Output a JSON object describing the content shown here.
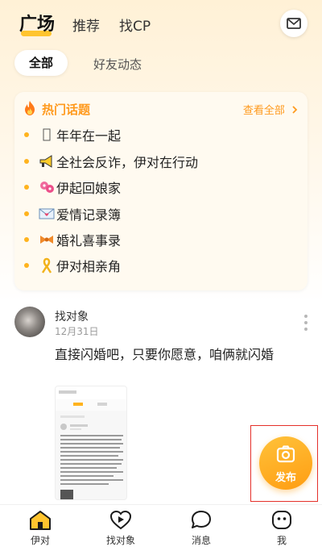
{
  "header": {
    "tabs": [
      {
        "label": "广场",
        "active": true
      },
      {
        "label": "推荐",
        "active": false
      },
      {
        "label": "找CP",
        "active": false
      }
    ],
    "mail_icon": "envelope-icon"
  },
  "filters": {
    "all": "全部",
    "friends": "好友动态"
  },
  "hot_topics": {
    "title": "热门话题",
    "see_all": "查看全部",
    "items": [
      {
        "icon": "calendar-emoji-icon",
        "label": "年年在一起"
      },
      {
        "icon": "megaphone-icon",
        "label": "全社会反诈，伊对在行动"
      },
      {
        "icon": "flowers-icon",
        "label": "伊起回娘家"
      },
      {
        "icon": "love-letter-icon",
        "label": "爱情记录簿"
      },
      {
        "icon": "ribbon-bow-icon",
        "label": "婚礼喜事录"
      },
      {
        "icon": "awareness-ribbon-icon",
        "label": "伊对相亲角"
      }
    ]
  },
  "post": {
    "author": "找对象",
    "date": "12月31日",
    "text": "直接闪婚吧，只要你愿意，咱俩就闪婚"
  },
  "fab": {
    "label": "发布"
  },
  "bottom_nav": [
    {
      "label": "伊对",
      "icon": "home-icon",
      "active": true
    },
    {
      "label": "找对象",
      "icon": "heart-play-icon",
      "active": false
    },
    {
      "label": "消息",
      "icon": "chat-bubble-icon",
      "active": false
    },
    {
      "label": "我",
      "icon": "profile-icon",
      "active": false
    }
  ],
  "colors": {
    "accent": "#ffb31e",
    "accent_text": "#ff9a1e"
  }
}
